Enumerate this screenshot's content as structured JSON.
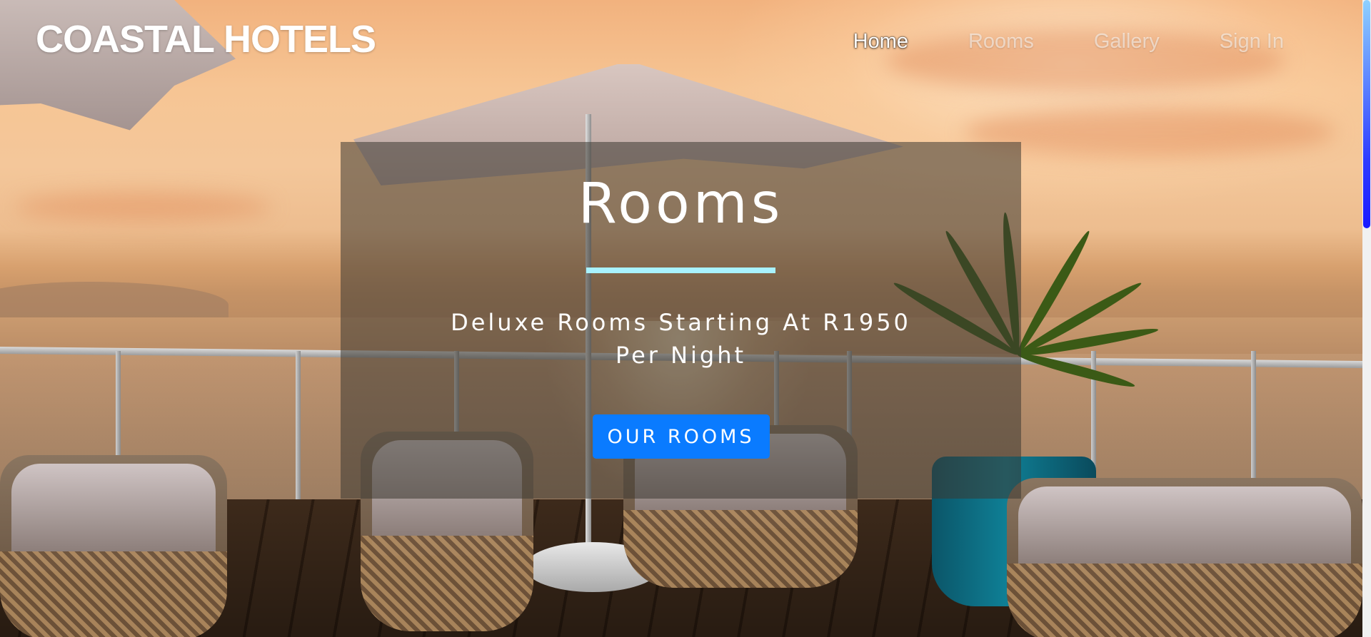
{
  "header": {
    "brand": "COASTAL HOTELS",
    "nav": [
      {
        "label": "Home",
        "active": true
      },
      {
        "label": "Rooms",
        "active": false
      },
      {
        "label": "Gallery",
        "active": false
      },
      {
        "label": "Sign In",
        "active": false
      }
    ]
  },
  "hero": {
    "title": "Rooms",
    "subtitle": "Deluxe Rooms Starting At R1950 Per Night",
    "cta_label": "OUR ROOMS",
    "accent_color": "#a8f2ff",
    "button_color": "#0a7bff"
  }
}
